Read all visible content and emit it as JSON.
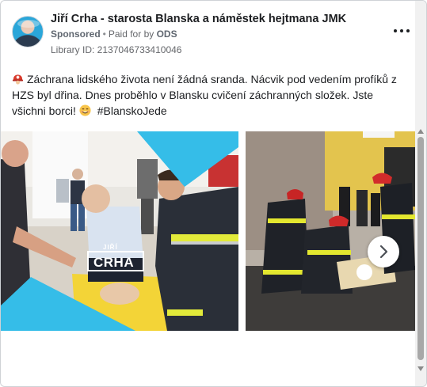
{
  "advertiser": {
    "name": "Jiří Crha - starosta Blanska a náměstek hejtmana JMK",
    "sponsored_label": "Sponsored",
    "paid_for_by_prefix": "Paid for by",
    "paid_for_by": "ODS",
    "library_id": "Library ID: 2137046733410046"
  },
  "post": {
    "text_main": "Záchrana lidského života není žádná sranda. Nácvik pod vedením profíků z HZS byl dřina. Dnes proběhlo v Blansku cvičení záchranných složek. Jste všichni borci!",
    "hashtag": "#BlanskoJede",
    "leading_emoji": "rescue-worker-helmet",
    "trailing_emoji": "smiling-face"
  },
  "carousel": {
    "image1_logo_top": "JIŘÍ",
    "image1_logo_main": "CRHA"
  },
  "colors": {
    "accent_cyan": "#35bde8",
    "firefighter_yellow": "#f2d82c",
    "helmet_red": "#d92727"
  }
}
